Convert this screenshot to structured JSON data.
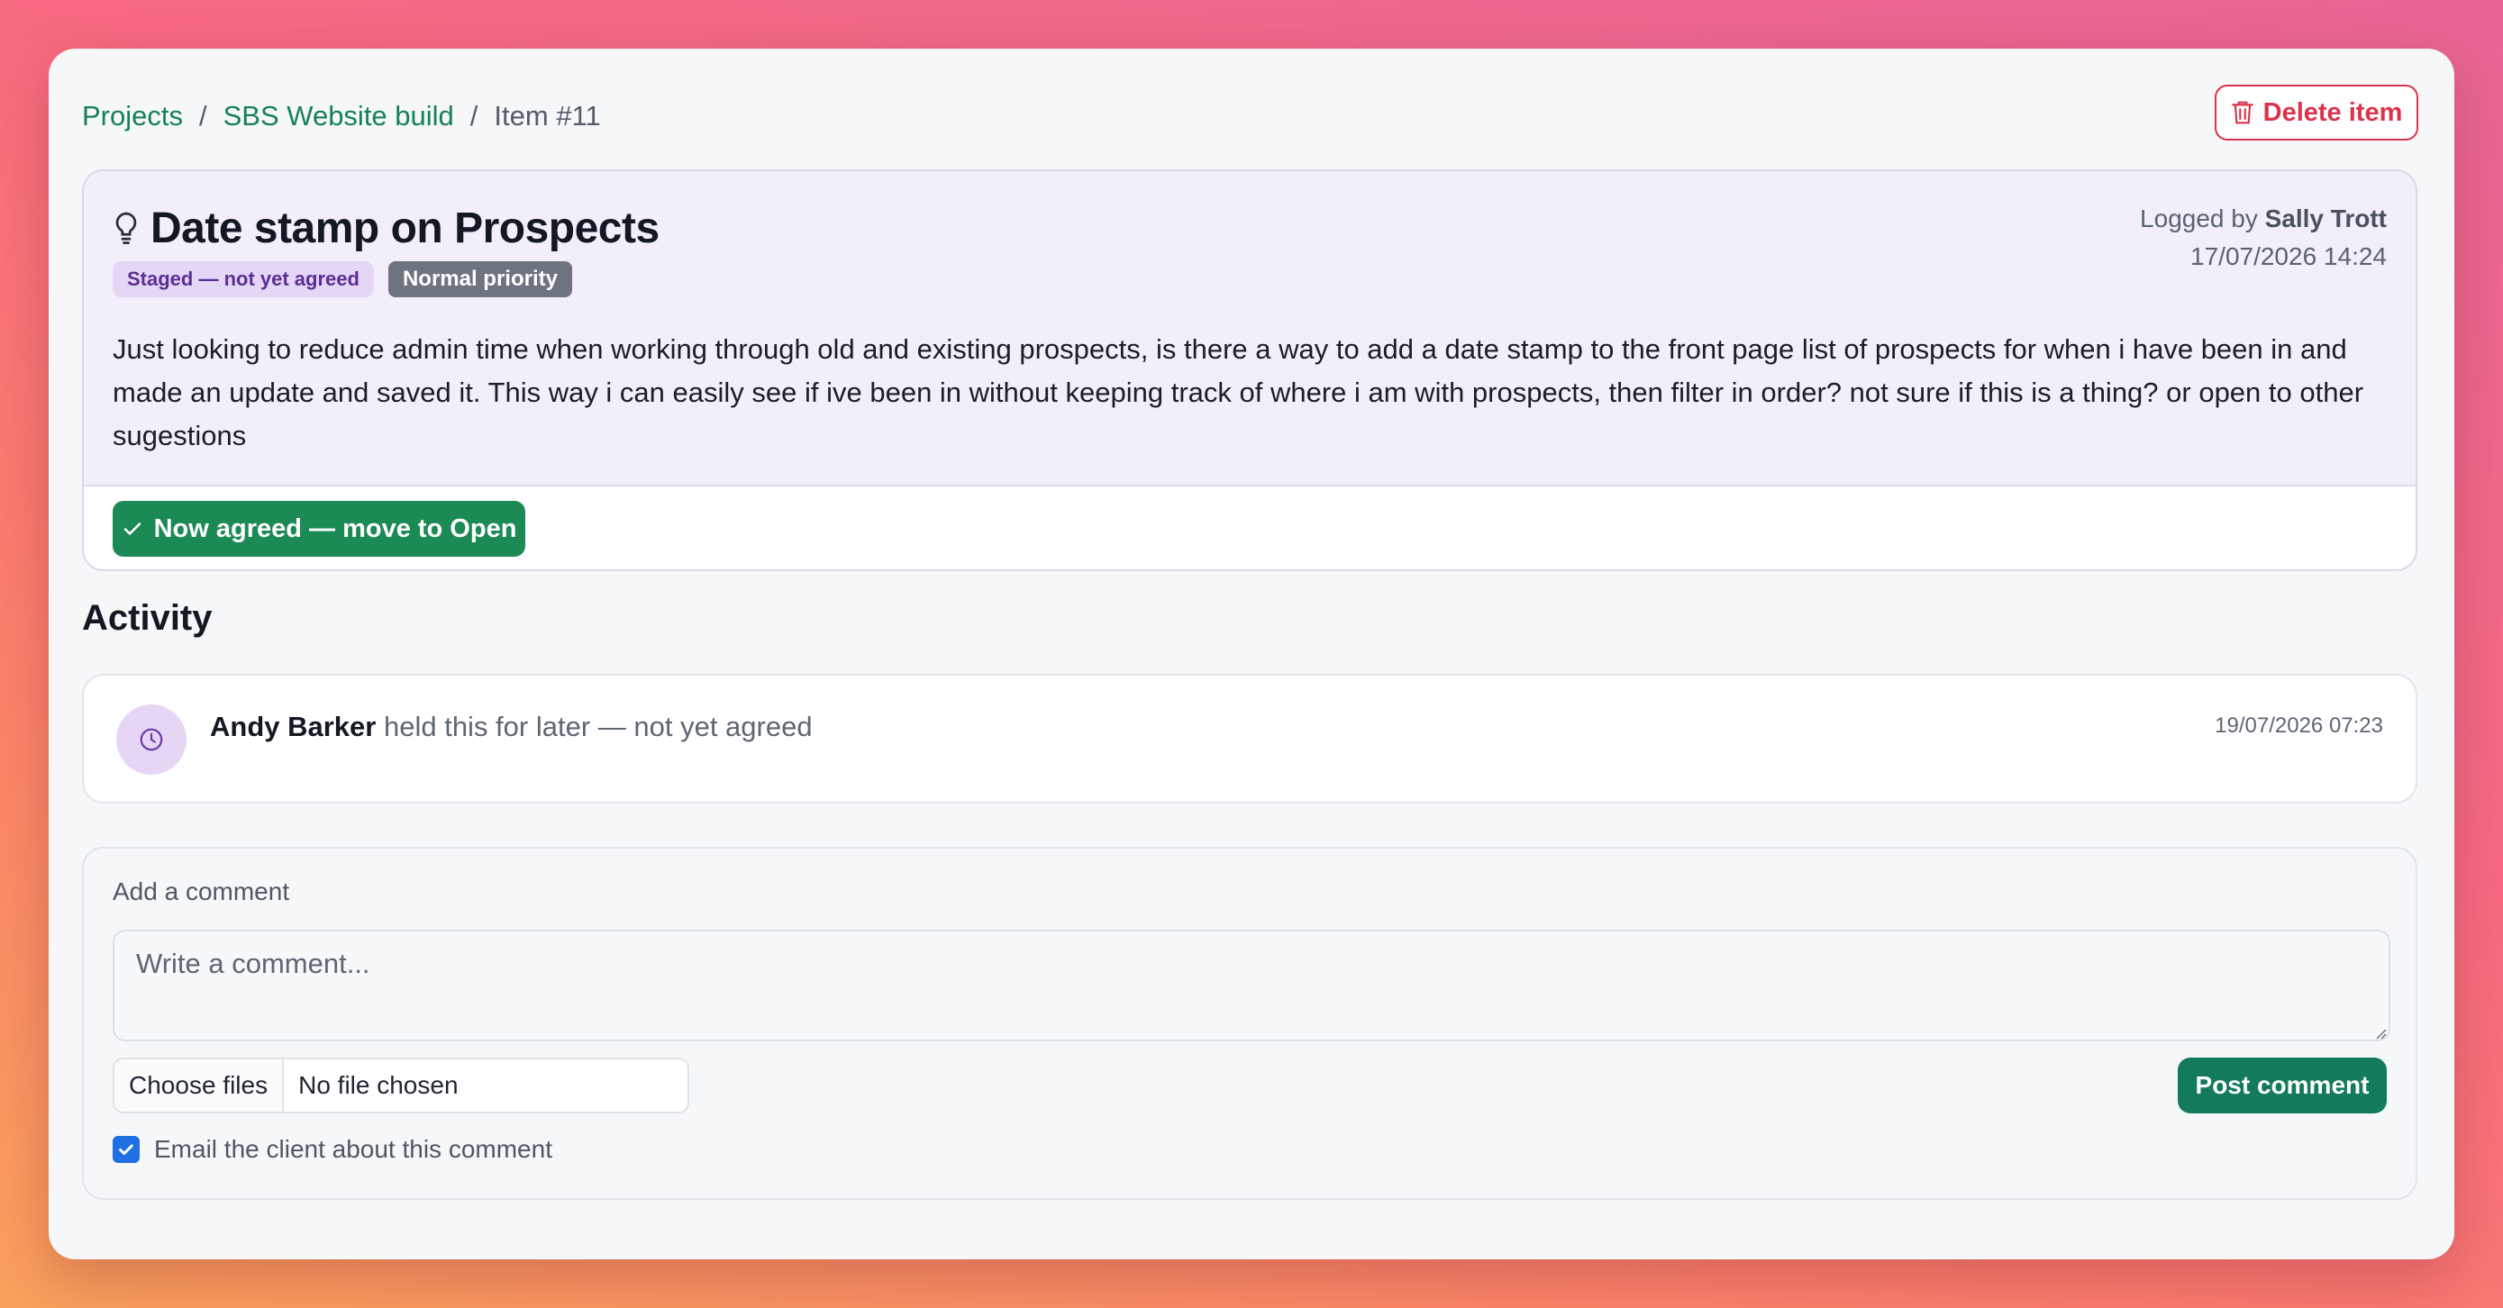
{
  "breadcrumb": {
    "projects": "Projects",
    "separator": "/",
    "project": "SBS Website build",
    "current": "Item #11"
  },
  "actions": {
    "delete_label": "Delete item"
  },
  "item": {
    "icon": "lightbulb-icon",
    "title": "Date stamp on Prospects",
    "status_badge": "Staged — not yet agreed",
    "priority_badge": "Normal priority",
    "logged_prefix": "Logged by",
    "logged_by": "Sally Trott",
    "logged_at": "17/07/2026 14:24",
    "description": "Just looking to reduce admin time when working through old and existing prospects, is there a way to add a date stamp to the front page list of prospects for when i have been in and made an update and saved it. This way i can easily see if ive been in without keeping track of where i am with prospects, then filter in order? not sure if this is a thing? or open to other sugestions",
    "agree_label": "Now agreed — move to Open"
  },
  "activity": {
    "heading": "Activity",
    "entries": [
      {
        "icon": "clock-icon",
        "who": "Andy Barker",
        "what": "held this for later — not yet agreed",
        "when": "19/07/2026 07:23"
      }
    ]
  },
  "comment": {
    "label": "Add a comment",
    "placeholder": "Write a comment...",
    "choose_files": "Choose files",
    "file_status": "No file chosen",
    "post_label": "Post comment",
    "email_label": "Email the client about this comment",
    "email_checked": true
  },
  "colors": {
    "accent_green": "#16805c",
    "danger": "#d9344b",
    "staged_bg": "#e4d7f6",
    "checkbox_blue": "#1f6fe5"
  }
}
